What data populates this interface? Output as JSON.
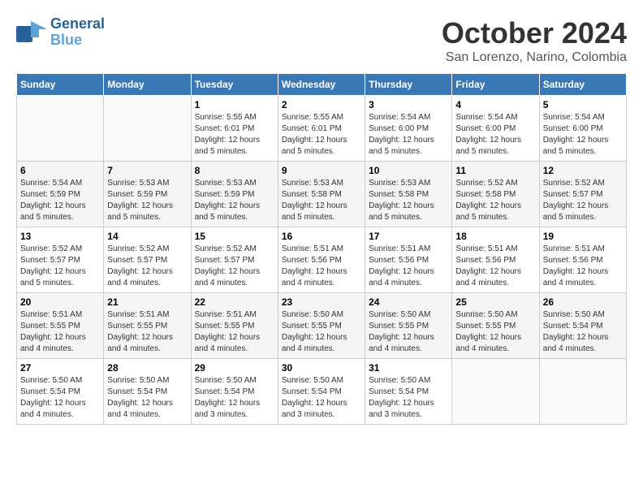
{
  "header": {
    "logo_line1": "General",
    "logo_line2": "Blue",
    "month": "October 2024",
    "location": "San Lorenzo, Narino, Colombia"
  },
  "days_of_week": [
    "Sunday",
    "Monday",
    "Tuesday",
    "Wednesday",
    "Thursday",
    "Friday",
    "Saturday"
  ],
  "weeks": [
    [
      {
        "day": "",
        "sunrise": "",
        "sunset": "",
        "daylight": ""
      },
      {
        "day": "",
        "sunrise": "",
        "sunset": "",
        "daylight": ""
      },
      {
        "day": "1",
        "sunrise": "Sunrise: 5:55 AM",
        "sunset": "Sunset: 6:01 PM",
        "daylight": "Daylight: 12 hours and 5 minutes."
      },
      {
        "day": "2",
        "sunrise": "Sunrise: 5:55 AM",
        "sunset": "Sunset: 6:01 PM",
        "daylight": "Daylight: 12 hours and 5 minutes."
      },
      {
        "day": "3",
        "sunrise": "Sunrise: 5:54 AM",
        "sunset": "Sunset: 6:00 PM",
        "daylight": "Daylight: 12 hours and 5 minutes."
      },
      {
        "day": "4",
        "sunrise": "Sunrise: 5:54 AM",
        "sunset": "Sunset: 6:00 PM",
        "daylight": "Daylight: 12 hours and 5 minutes."
      },
      {
        "day": "5",
        "sunrise": "Sunrise: 5:54 AM",
        "sunset": "Sunset: 6:00 PM",
        "daylight": "Daylight: 12 hours and 5 minutes."
      }
    ],
    [
      {
        "day": "6",
        "sunrise": "Sunrise: 5:54 AM",
        "sunset": "Sunset: 5:59 PM",
        "daylight": "Daylight: 12 hours and 5 minutes."
      },
      {
        "day": "7",
        "sunrise": "Sunrise: 5:53 AM",
        "sunset": "Sunset: 5:59 PM",
        "daylight": "Daylight: 12 hours and 5 minutes."
      },
      {
        "day": "8",
        "sunrise": "Sunrise: 5:53 AM",
        "sunset": "Sunset: 5:59 PM",
        "daylight": "Daylight: 12 hours and 5 minutes."
      },
      {
        "day": "9",
        "sunrise": "Sunrise: 5:53 AM",
        "sunset": "Sunset: 5:58 PM",
        "daylight": "Daylight: 12 hours and 5 minutes."
      },
      {
        "day": "10",
        "sunrise": "Sunrise: 5:53 AM",
        "sunset": "Sunset: 5:58 PM",
        "daylight": "Daylight: 12 hours and 5 minutes."
      },
      {
        "day": "11",
        "sunrise": "Sunrise: 5:52 AM",
        "sunset": "Sunset: 5:58 PM",
        "daylight": "Daylight: 12 hours and 5 minutes."
      },
      {
        "day": "12",
        "sunrise": "Sunrise: 5:52 AM",
        "sunset": "Sunset: 5:57 PM",
        "daylight": "Daylight: 12 hours and 5 minutes."
      }
    ],
    [
      {
        "day": "13",
        "sunrise": "Sunrise: 5:52 AM",
        "sunset": "Sunset: 5:57 PM",
        "daylight": "Daylight: 12 hours and 5 minutes."
      },
      {
        "day": "14",
        "sunrise": "Sunrise: 5:52 AM",
        "sunset": "Sunset: 5:57 PM",
        "daylight": "Daylight: 12 hours and 4 minutes."
      },
      {
        "day": "15",
        "sunrise": "Sunrise: 5:52 AM",
        "sunset": "Sunset: 5:57 PM",
        "daylight": "Daylight: 12 hours and 4 minutes."
      },
      {
        "day": "16",
        "sunrise": "Sunrise: 5:51 AM",
        "sunset": "Sunset: 5:56 PM",
        "daylight": "Daylight: 12 hours and 4 minutes."
      },
      {
        "day": "17",
        "sunrise": "Sunrise: 5:51 AM",
        "sunset": "Sunset: 5:56 PM",
        "daylight": "Daylight: 12 hours and 4 minutes."
      },
      {
        "day": "18",
        "sunrise": "Sunrise: 5:51 AM",
        "sunset": "Sunset: 5:56 PM",
        "daylight": "Daylight: 12 hours and 4 minutes."
      },
      {
        "day": "19",
        "sunrise": "Sunrise: 5:51 AM",
        "sunset": "Sunset: 5:56 PM",
        "daylight": "Daylight: 12 hours and 4 minutes."
      }
    ],
    [
      {
        "day": "20",
        "sunrise": "Sunrise: 5:51 AM",
        "sunset": "Sunset: 5:55 PM",
        "daylight": "Daylight: 12 hours and 4 minutes."
      },
      {
        "day": "21",
        "sunrise": "Sunrise: 5:51 AM",
        "sunset": "Sunset: 5:55 PM",
        "daylight": "Daylight: 12 hours and 4 minutes."
      },
      {
        "day": "22",
        "sunrise": "Sunrise: 5:51 AM",
        "sunset": "Sunset: 5:55 PM",
        "daylight": "Daylight: 12 hours and 4 minutes."
      },
      {
        "day": "23",
        "sunrise": "Sunrise: 5:50 AM",
        "sunset": "Sunset: 5:55 PM",
        "daylight": "Daylight: 12 hours and 4 minutes."
      },
      {
        "day": "24",
        "sunrise": "Sunrise: 5:50 AM",
        "sunset": "Sunset: 5:55 PM",
        "daylight": "Daylight: 12 hours and 4 minutes."
      },
      {
        "day": "25",
        "sunrise": "Sunrise: 5:50 AM",
        "sunset": "Sunset: 5:55 PM",
        "daylight": "Daylight: 12 hours and 4 minutes."
      },
      {
        "day": "26",
        "sunrise": "Sunrise: 5:50 AM",
        "sunset": "Sunset: 5:54 PM",
        "daylight": "Daylight: 12 hours and 4 minutes."
      }
    ],
    [
      {
        "day": "27",
        "sunrise": "Sunrise: 5:50 AM",
        "sunset": "Sunset: 5:54 PM",
        "daylight": "Daylight: 12 hours and 4 minutes."
      },
      {
        "day": "28",
        "sunrise": "Sunrise: 5:50 AM",
        "sunset": "Sunset: 5:54 PM",
        "daylight": "Daylight: 12 hours and 4 minutes."
      },
      {
        "day": "29",
        "sunrise": "Sunrise: 5:50 AM",
        "sunset": "Sunset: 5:54 PM",
        "daylight": "Daylight: 12 hours and 3 minutes."
      },
      {
        "day": "30",
        "sunrise": "Sunrise: 5:50 AM",
        "sunset": "Sunset: 5:54 PM",
        "daylight": "Daylight: 12 hours and 3 minutes."
      },
      {
        "day": "31",
        "sunrise": "Sunrise: 5:50 AM",
        "sunset": "Sunset: 5:54 PM",
        "daylight": "Daylight: 12 hours and 3 minutes."
      },
      {
        "day": "",
        "sunrise": "",
        "sunset": "",
        "daylight": ""
      },
      {
        "day": "",
        "sunrise": "",
        "sunset": "",
        "daylight": ""
      }
    ]
  ]
}
